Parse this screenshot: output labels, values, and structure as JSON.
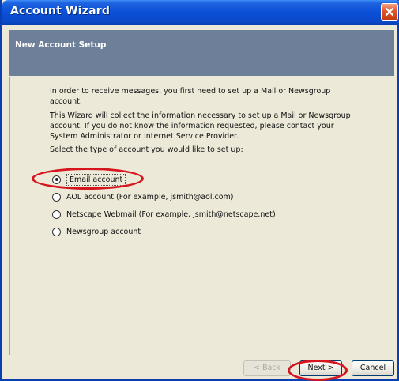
{
  "window": {
    "title": "Account Wizard"
  },
  "banner": {
    "title": "New Account Setup"
  },
  "intro": {
    "p1": "In order to receive messages, you first need to set up a Mail or Newsgroup account.",
    "p2": "This Wizard will collect the information necessary to set up a Mail or Newsgroup account. If you do not know the information requested, please contact your System Administrator or Internet Service Provider.",
    "p3": "Select the type of account you would like to set up:"
  },
  "options": [
    {
      "label": "Email account",
      "checked": true
    },
    {
      "label": "AOL account (For example, jsmith@aol.com)",
      "checked": false
    },
    {
      "label": "Netscape Webmail (For example, jsmith@netscape.net)",
      "checked": false
    },
    {
      "label": "Newsgroup account",
      "checked": false
    }
  ],
  "buttons": {
    "back": "< Back",
    "next": "Next >",
    "cancel": "Cancel"
  },
  "colors": {
    "annotation": "#D6161E",
    "title_bar": "#0A4FD6",
    "banner": "#6E7F99"
  }
}
